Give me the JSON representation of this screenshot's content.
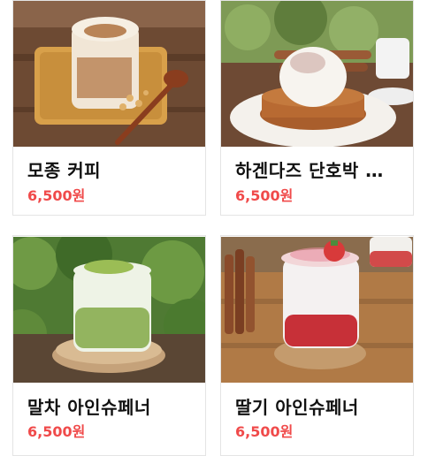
{
  "products": [
    {
      "name": "모종 커피",
      "price": "6,500원"
    },
    {
      "name": "하겐다즈 단호박 …",
      "price": "6,500원"
    },
    {
      "name": "말차 아인슈페너",
      "price": "6,500원"
    },
    {
      "name": "딸기 아인슈페너",
      "price": "6,500원"
    }
  ]
}
